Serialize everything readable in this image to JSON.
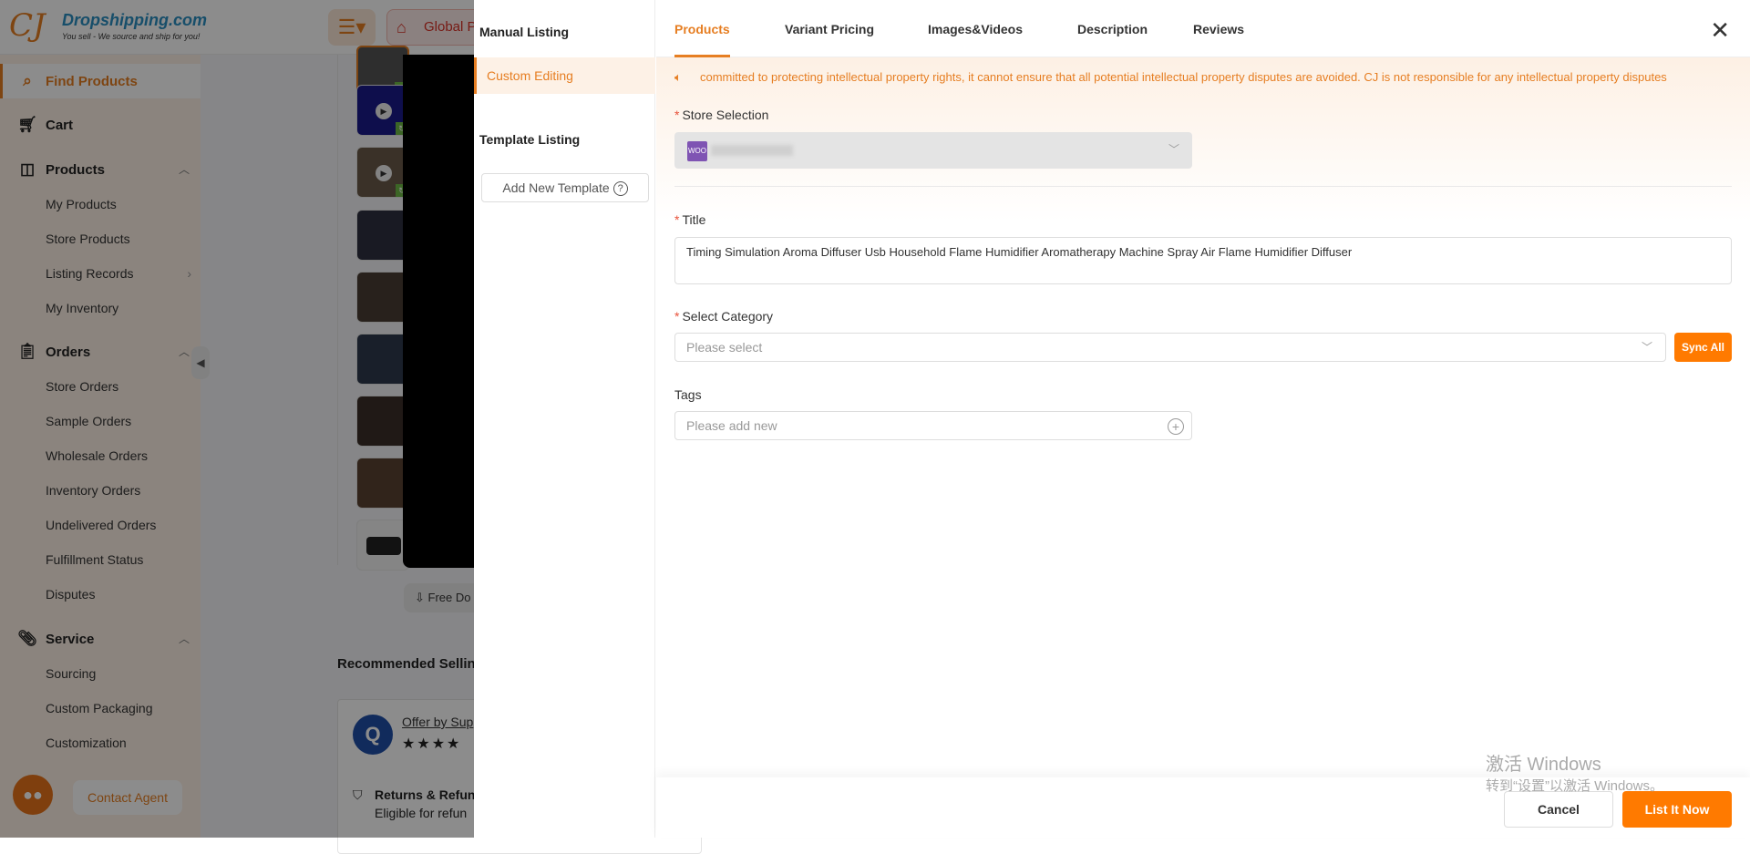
{
  "header": {
    "logo_mark": "CJ",
    "brand": "Dropshipping.com",
    "tagline": "You sell - We source and ship for you!",
    "menu_icon": "list-icon",
    "global_label": "Global Pr"
  },
  "sidebar": {
    "find_products": "Find Products",
    "cart": "Cart",
    "products": {
      "label": "Products",
      "items": [
        "My Products",
        "Store Products",
        "Listing Records",
        "My Inventory"
      ]
    },
    "orders": {
      "label": "Orders",
      "items": [
        "Store Orders",
        "Sample Orders",
        "Wholesale Orders",
        "Inventory Orders",
        "Undelivered Orders",
        "Fulfillment Status",
        "Disputes"
      ]
    },
    "service": {
      "label": "Service",
      "items": [
        "Sourcing",
        "Custom Packaging",
        "Customization"
      ]
    },
    "contact_agent": "Contact Agent"
  },
  "background": {
    "free_download": "Free Do",
    "recommended": "Recommended Selling",
    "offer_by": "Offer by Sup",
    "stars": "★★★★",
    "returns": "Returns & Refun",
    "eligible": "Eligible for refun"
  },
  "drawer": {
    "nav": {
      "manual_listing": "Manual Listing",
      "custom_editing": "Custom Editing",
      "template_listing": "Template Listing",
      "add_template": "Add New Template"
    },
    "tabs": [
      "Products",
      "Variant Pricing",
      "Images&Videos",
      "Description",
      "Reviews"
    ],
    "active_tab": "Products",
    "notice": "committed to protecting intellectual property rights, it cannot ensure that all potential intellectual property disputes are avoided. CJ is not responsible for any intellectual property disputes",
    "store_selection": {
      "label": "Store Selection",
      "store_icon": "WOO"
    },
    "title": {
      "label": "Title",
      "value": "Timing Simulation Aroma Diffuser Usb Household Flame Humidifier  Aromatherapy Machine Spray Air Flame Humidifier Diffuser"
    },
    "category": {
      "label": "Select Category",
      "placeholder": "Please select",
      "sync_all": "Sync All"
    },
    "tags": {
      "label": "Tags",
      "placeholder": "Please add new"
    },
    "footer": {
      "cancel": "Cancel",
      "list_now": "List It Now"
    }
  },
  "watermark": {
    "line1": "激活 Windows",
    "line2": "转到“设置”以激活 Windows。"
  }
}
